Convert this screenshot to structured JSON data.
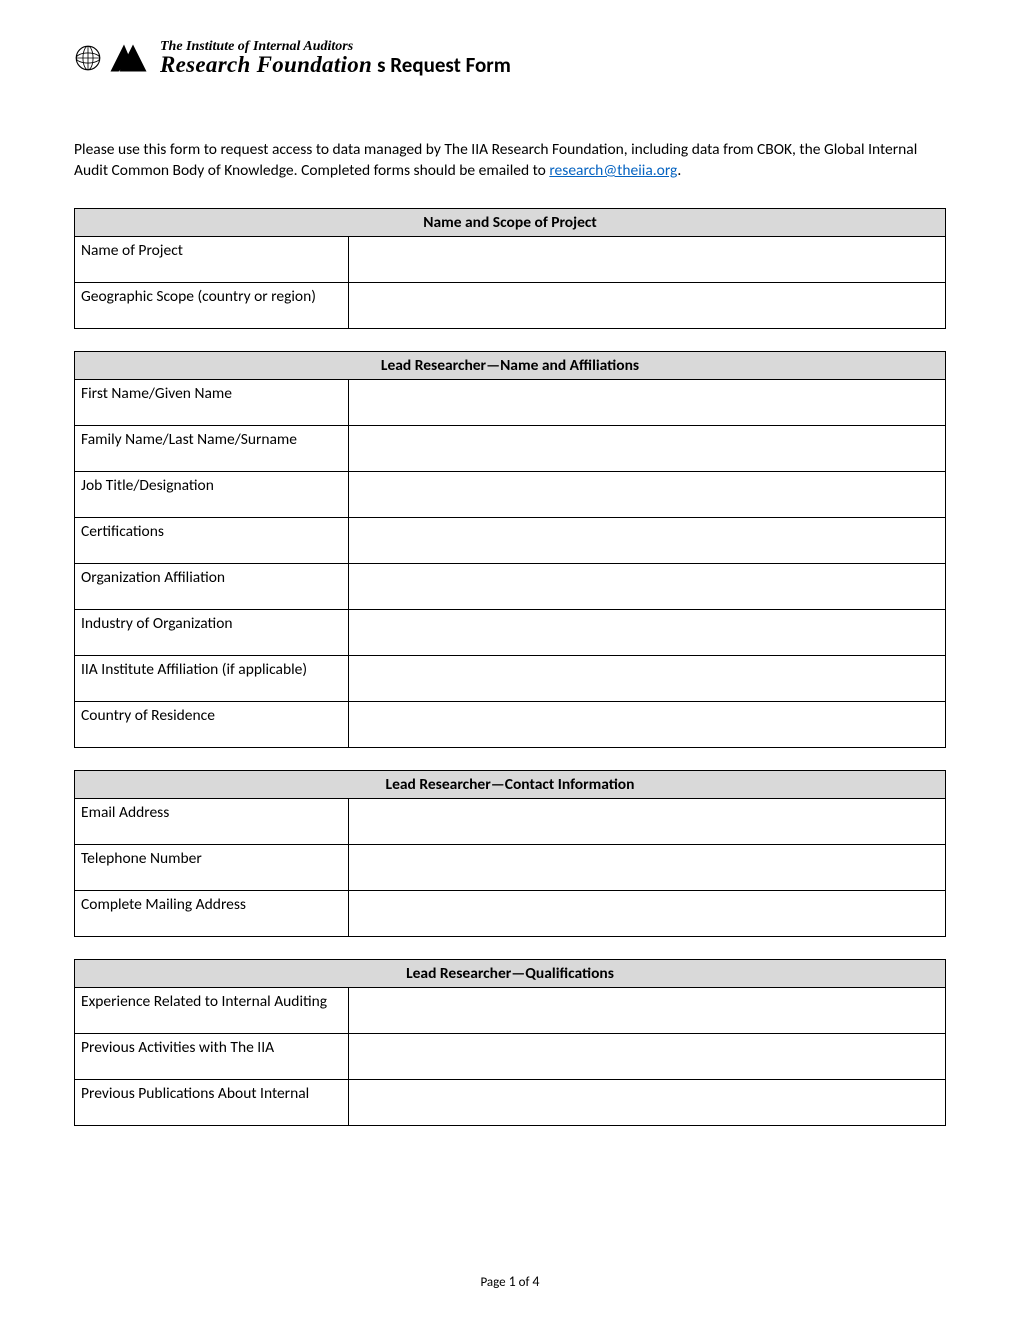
{
  "header": {
    "logo_line1": "The Institute of Internal Auditors",
    "logo_line2": "Research Foundation",
    "title_suffix": "s Request Form"
  },
  "intro": {
    "text1": "Please use this form to request access to data managed by The IIA Research Foundation, including data from CBOK, the Global Internal Audit Common Body of Knowledge. Completed forms should be emailed to ",
    "email": "research@theiia.org",
    "text2": "."
  },
  "sections": {
    "s1": {
      "heading": "Name and Scope of Project",
      "rows": {
        "name": "Name of Project",
        "geo": "Geographic Scope (country or region)"
      }
    },
    "s2": {
      "heading": "Lead Researcher—Name and Affiliations",
      "rows": {
        "first": "First Name/Given Name",
        "family": "Family Name/Last Name/Surname",
        "title": "Job Title/Designation",
        "certs": "Certifications",
        "org": "Organization Affiliation",
        "industry": "Industry of Organization",
        "iia": "IIA Institute Affiliation (if applicable)",
        "country": "Country of Residence"
      }
    },
    "s3": {
      "heading": "Lead Researcher—Contact Information",
      "rows": {
        "email": "Email Address",
        "phone": "Telephone Number",
        "mail": "Complete Mailing Address"
      }
    },
    "s4": {
      "heading": "Lead Researcher—Qualifications",
      "rows": {
        "exp": "Experience Related to Internal Auditing",
        "prev_act": "Previous Activities with The IIA",
        "pubs": "Previous Publications About Internal"
      }
    }
  },
  "footer": {
    "prefix": "Page ",
    "current": "1",
    "of": " of ",
    "total": "4"
  }
}
